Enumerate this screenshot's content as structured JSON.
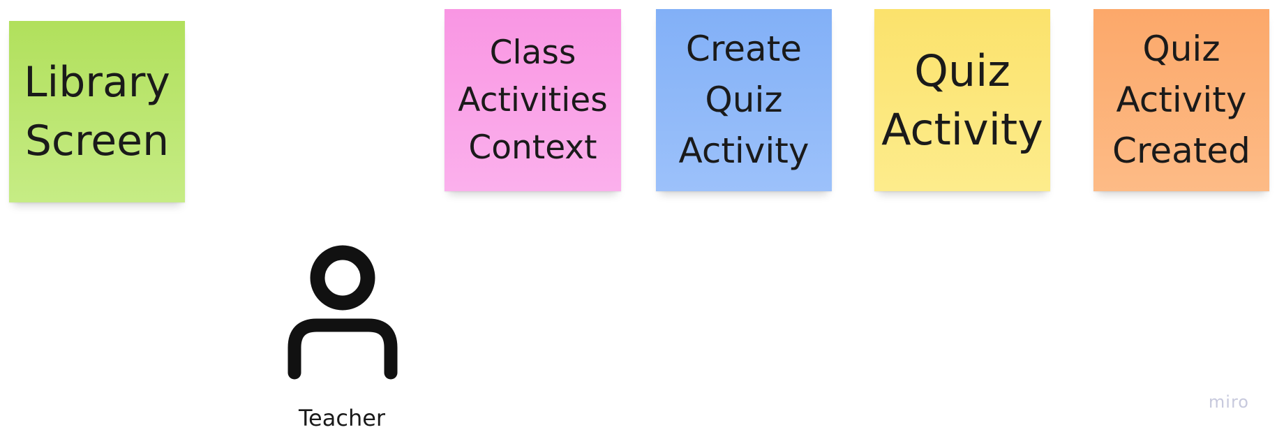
{
  "notes": {
    "library": {
      "lines": [
        "Library",
        "Screen"
      ],
      "color": "#b8e465"
    },
    "context": {
      "lines": [
        "Class",
        "Activities",
        "Context"
      ],
      "color": "#fa9fe7"
    },
    "create": {
      "lines": [
        "Create",
        "Quiz",
        "Activity"
      ],
      "color": "#8ab6f8"
    },
    "quiz": {
      "lines": [
        "Quiz",
        "Activity"
      ],
      "color": "#fce677"
    },
    "created": {
      "lines": [
        "Quiz",
        "Activity",
        "Created"
      ],
      "color": "#fcb175"
    }
  },
  "actor": {
    "icon": "person-icon",
    "label": "Teacher"
  },
  "watermark": "miro"
}
